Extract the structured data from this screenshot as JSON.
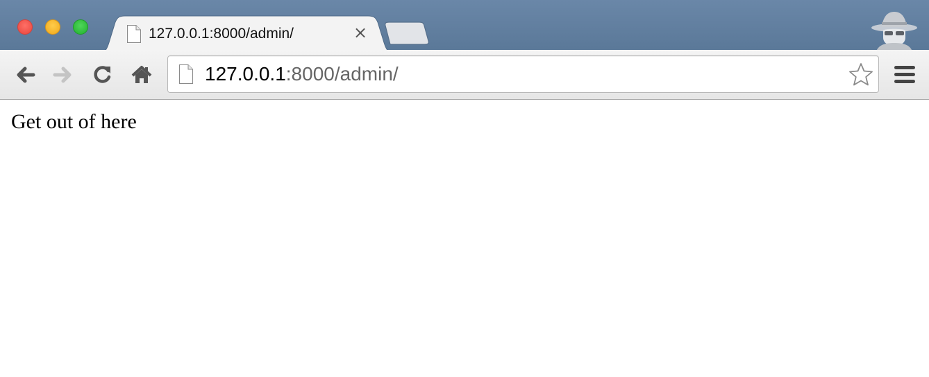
{
  "window": {
    "traffic_lights": [
      "close",
      "minimize",
      "zoom"
    ],
    "incognito_icon": "incognito-icon"
  },
  "tab": {
    "title": "127.0.0.1:8000/admin/",
    "icon": "page-icon",
    "close_icon": "close-icon",
    "close_glyph": "×"
  },
  "toolbar": {
    "back_icon": "back-arrow-icon",
    "forward_icon": "forward-arrow-icon",
    "reload_icon": "reload-icon",
    "home_icon": "home-icon",
    "menu_icon": "hamburger-menu-icon"
  },
  "omnibox": {
    "url_host": "127.0.0.1",
    "url_rest": ":8000/admin/",
    "page_icon": "page-icon",
    "bookmark_icon": "star-icon"
  },
  "page": {
    "body_text": "Get out of here"
  },
  "colors": {
    "titlebar": "#5f7d9d",
    "toolbar": "#ececec",
    "url_host": "#000000",
    "url_path": "#666666"
  }
}
